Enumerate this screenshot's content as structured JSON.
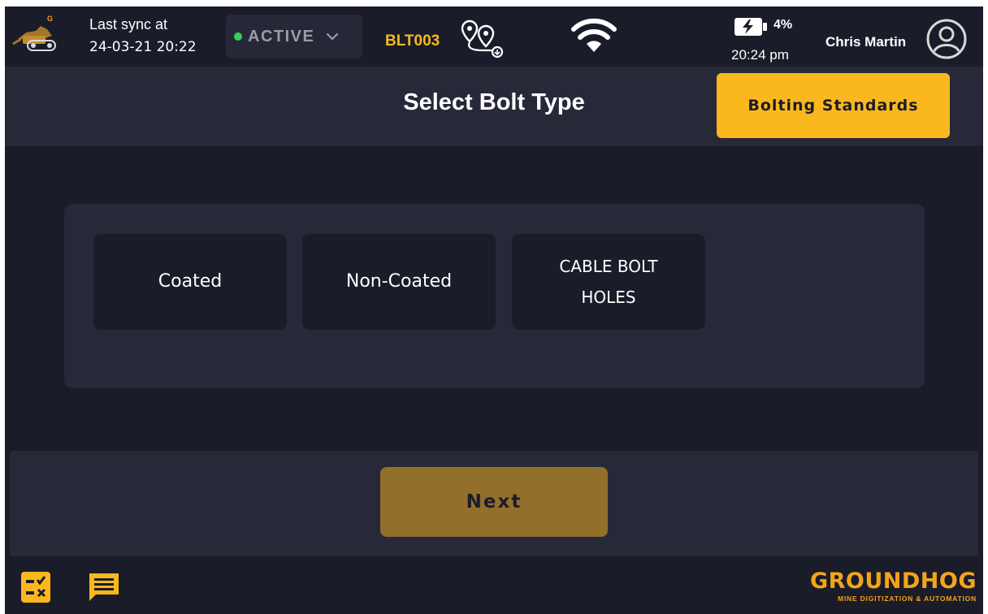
{
  "statusbar": {
    "sync_label": "Last sync at",
    "sync_time": "24-03-21 20:22",
    "status": "ACTIVE",
    "asset_code": "BLT003",
    "battery_percent": "4%",
    "time": "20:24 pm",
    "user_name": "Chris Martin",
    "icons": {
      "logo": "machine-logo-icon",
      "status_dropdown": "chevron-down-icon",
      "route": "route-pins-icon",
      "wifi": "wifi-icon",
      "battery": "battery-charging-icon",
      "avatar": "user-avatar-icon"
    }
  },
  "header": {
    "title": "Select Bolt Type",
    "standards_button": "Bolting Standards"
  },
  "bolt_types": [
    {
      "label": "Coated"
    },
    {
      "label": "Non-Coated"
    },
    {
      "label": "CABLE BOLT HOLES"
    }
  ],
  "actions": {
    "next": "Next"
  },
  "bottom_nav": {
    "icons": [
      "checklist-icon",
      "message-icon"
    ],
    "brand_name": "GROUNDHOG",
    "brand_tagline": "MINE DIGITIZATION & AUTOMATION"
  },
  "colors": {
    "background": "#1b1c29",
    "panel": "#272939",
    "accent": "#fbb81e",
    "accent_muted": "#926f2a",
    "active_dot": "#2fd45a",
    "brand": "#f3a51a"
  }
}
